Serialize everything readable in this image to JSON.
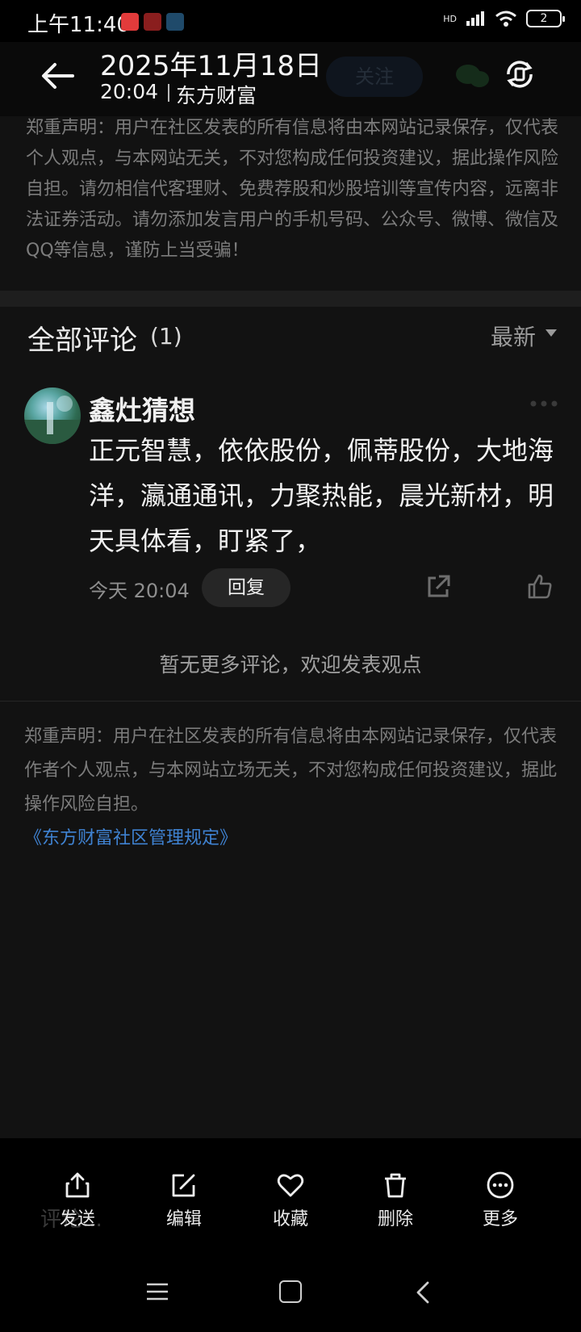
{
  "status_bar": {
    "time": "上午11:40",
    "battery": "2",
    "signal": "HD"
  },
  "header": {
    "date": "2025年11月18日",
    "time": "20:04",
    "source": "东方财富",
    "follow_label": "关注"
  },
  "disclaimer_top": "郑重声明：用户在社区发表的所有信息将由本网站记录保存，仅代表个人观点，与本网站无关，不对您构成任何投资建议，据此操作风险自担。请勿相信代客理财、免费荐股和炒股培训等宣传内容，远离非法证券活动。请勿添加发言用户的手机号码、公众号、微博、微信及QQ等信息，谨防上当受骗！",
  "comments": {
    "title": "全部评论",
    "count": "(1)",
    "sort": "最新",
    "items": [
      {
        "author": "鑫灶猜想",
        "body": "正元智慧，依依股份，佩蒂股份，大地海洋，瀛通通讯，力聚热能，晨光新材，明天具体看，盯紧了，",
        "time": "今天 20:04",
        "reply_label": "回复"
      }
    ],
    "no_more": "暂无更多评论，欢迎发表观点"
  },
  "disclaimer_bottom": "郑重声明：用户在社区发表的所有信息将由本网站记录保存，仅代表作者个人观点，与本网站立场无关，不对您构成任何投资建议，据此操作风险自担。",
  "rules_link": "《东方财富社区管理规定》",
  "action_bar": {
    "send": "发送",
    "edit": "编辑",
    "favorite": "收藏",
    "delete": "删除",
    "more": "更多"
  },
  "ghost_input": "评论..."
}
